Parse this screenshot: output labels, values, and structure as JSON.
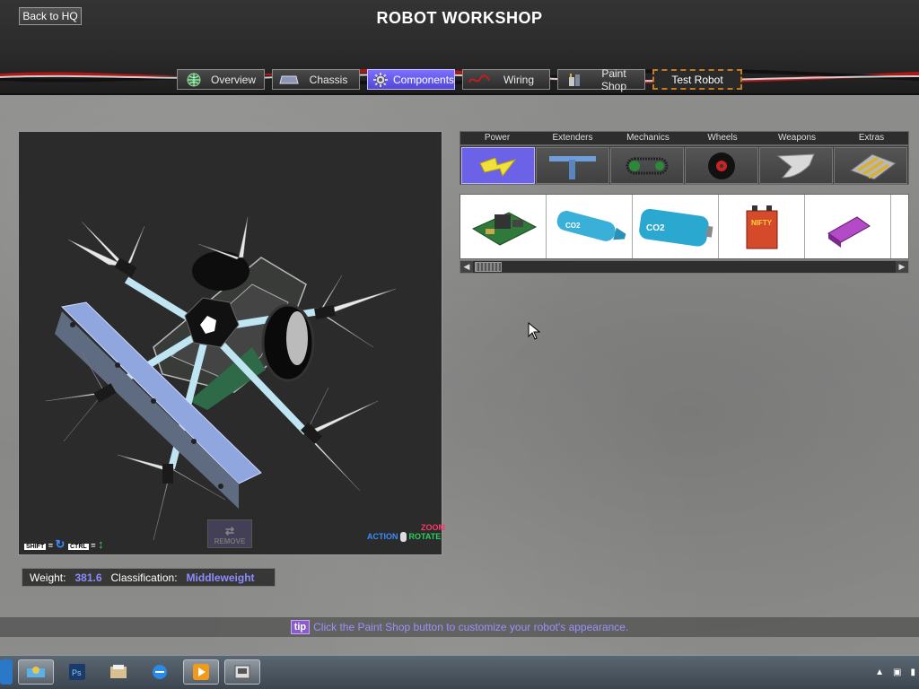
{
  "header": {
    "back_label": "Back to HQ",
    "title": "ROBOT WORKSHOP"
  },
  "tabs": [
    {
      "label": "Overview",
      "icon": "globe-icon"
    },
    {
      "label": "Chassis",
      "icon": "chassis-icon"
    },
    {
      "label": "Components",
      "icon": "gear-icon",
      "active": true
    },
    {
      "label": "Wiring",
      "icon": "wire-icon"
    },
    {
      "label": "Paint Shop",
      "icon": "paint-can-icon"
    },
    {
      "label": "Test Robot",
      "icon": ""
    }
  ],
  "viewport": {
    "shift_key": "SHIFT",
    "ctrl_key": "CTRL",
    "equals": "=",
    "zoom_label": "ZOOM",
    "action_label": "ACTION",
    "rotate_label": "ROTATE",
    "remove_label": "REMOVE"
  },
  "stats": {
    "weight_label": "Weight:",
    "weight_value": "381.6",
    "class_label": "Classification:",
    "class_value": "Middleweight"
  },
  "categories": [
    {
      "label": "Power",
      "icon": "lightning-icon",
      "active": true
    },
    {
      "label": "Extenders",
      "icon": "t-bar-icon"
    },
    {
      "label": "Mechanics",
      "icon": "chain-gear-icon"
    },
    {
      "label": "Wheels",
      "icon": "wheel-icon"
    },
    {
      "label": "Weapons",
      "icon": "blade-icon"
    },
    {
      "label": "Extras",
      "icon": "plate-icon"
    }
  ],
  "items": [
    {
      "name": "circuit-board",
      "label": ""
    },
    {
      "name": "co2-canister-small",
      "label": "CO2"
    },
    {
      "name": "co2-tank",
      "label": "CO2"
    },
    {
      "name": "nifty-battery",
      "label": "NIFTY"
    },
    {
      "name": "purple-battery",
      "label": ""
    }
  ],
  "tip": {
    "badge": "tip",
    "text": "Click the Paint Shop button to customize your robot's appearance."
  },
  "colors": {
    "accent": "#6c62e8",
    "weight_value": "#8c8cff",
    "test_border": "#c77b1e"
  }
}
